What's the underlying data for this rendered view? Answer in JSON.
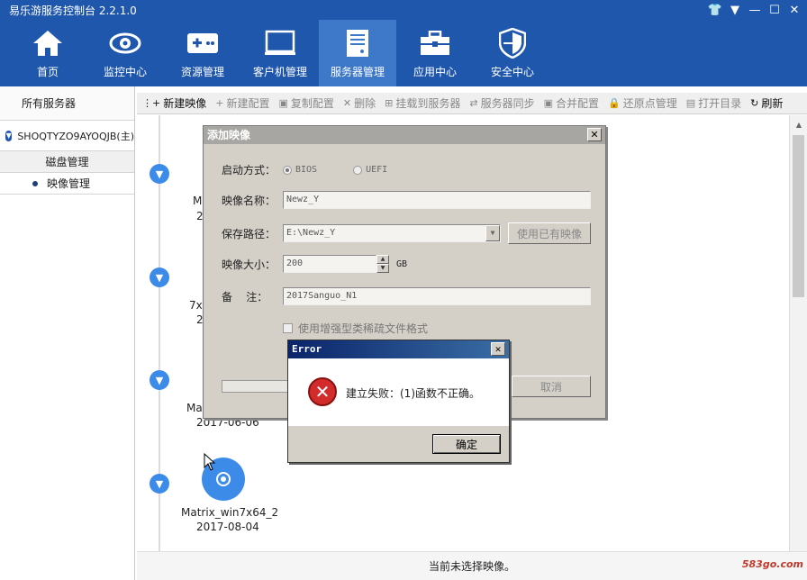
{
  "app": {
    "title": "易乐游服务控制台 2.2.1.0"
  },
  "window_controls": {
    "shirt": "👕",
    "menu": "▼",
    "minimize": "—",
    "maximize": "☐",
    "close": "✕"
  },
  "nav": [
    {
      "label": "首页",
      "icon": "home-icon"
    },
    {
      "label": "监控中心",
      "icon": "eye-icon"
    },
    {
      "label": "资源管理",
      "icon": "gamepad-icon"
    },
    {
      "label": "客户机管理",
      "icon": "monitor-icon"
    },
    {
      "label": "服务器管理",
      "icon": "server-icon",
      "active": true
    },
    {
      "label": "应用中心",
      "icon": "toolbox-icon"
    },
    {
      "label": "安全中心",
      "icon": "shield-icon"
    }
  ],
  "sidebar": {
    "header": "所有服务器",
    "server": "SHOQTYZO9AYOQJB(主)",
    "disk": "磁盘管理",
    "images": "映像管理"
  },
  "toolbar": [
    {
      "label": "新建映像",
      "icon": "⋮+",
      "enabled": true
    },
    {
      "label": "新建配置",
      "icon": "+",
      "enabled": false
    },
    {
      "label": "复制配置",
      "icon": "▣",
      "enabled": false
    },
    {
      "label": "删除",
      "icon": "✕",
      "enabled": false
    },
    {
      "label": "挂载到服务器",
      "icon": "⊞",
      "enabled": false
    },
    {
      "label": "服务器同步",
      "icon": "⇄",
      "enabled": false
    },
    {
      "label": "合并配置",
      "icon": "▣",
      "enabled": false
    },
    {
      "label": "还原点管理",
      "icon": "🔒",
      "enabled": false
    },
    {
      "label": "打开目录",
      "icon": "▤",
      "enabled": false
    },
    {
      "label": "刷新",
      "icon": "↻",
      "enabled": true
    }
  ],
  "timeline": {
    "items": [
      {
        "name": "M",
        "date": "2"
      },
      {
        "name": "7x",
        "date": "2"
      },
      {
        "name": "Ma",
        "date": "2017-06-06"
      },
      {
        "name": "Matrix_win7x64_2",
        "date": "2017-08-04"
      }
    ]
  },
  "status": {
    "text": "当前未选择映像。"
  },
  "watermark": "583go.com",
  "add_dialog": {
    "title": "添加映像",
    "boot_label": "启动方式：",
    "boot_options": [
      "BIOS",
      "UEFI"
    ],
    "name_label": "映像名称：",
    "name_value": "Newz_Y",
    "path_label": "保存路径：",
    "path_value": "E:\\Newz_Y",
    "use_existing": "使用已有映像",
    "size_label": "映像大小：",
    "size_value": "200",
    "size_unit": "GB",
    "note_label": "备    注：",
    "note_value": "2017Sanguo_N1",
    "sparse_label": "使用增强型类稀疏文件格式",
    "cancel": "取消"
  },
  "error_dialog": {
    "title": "Error",
    "message": "建立失败：(1)函数不正确。",
    "ok": "确定"
  }
}
